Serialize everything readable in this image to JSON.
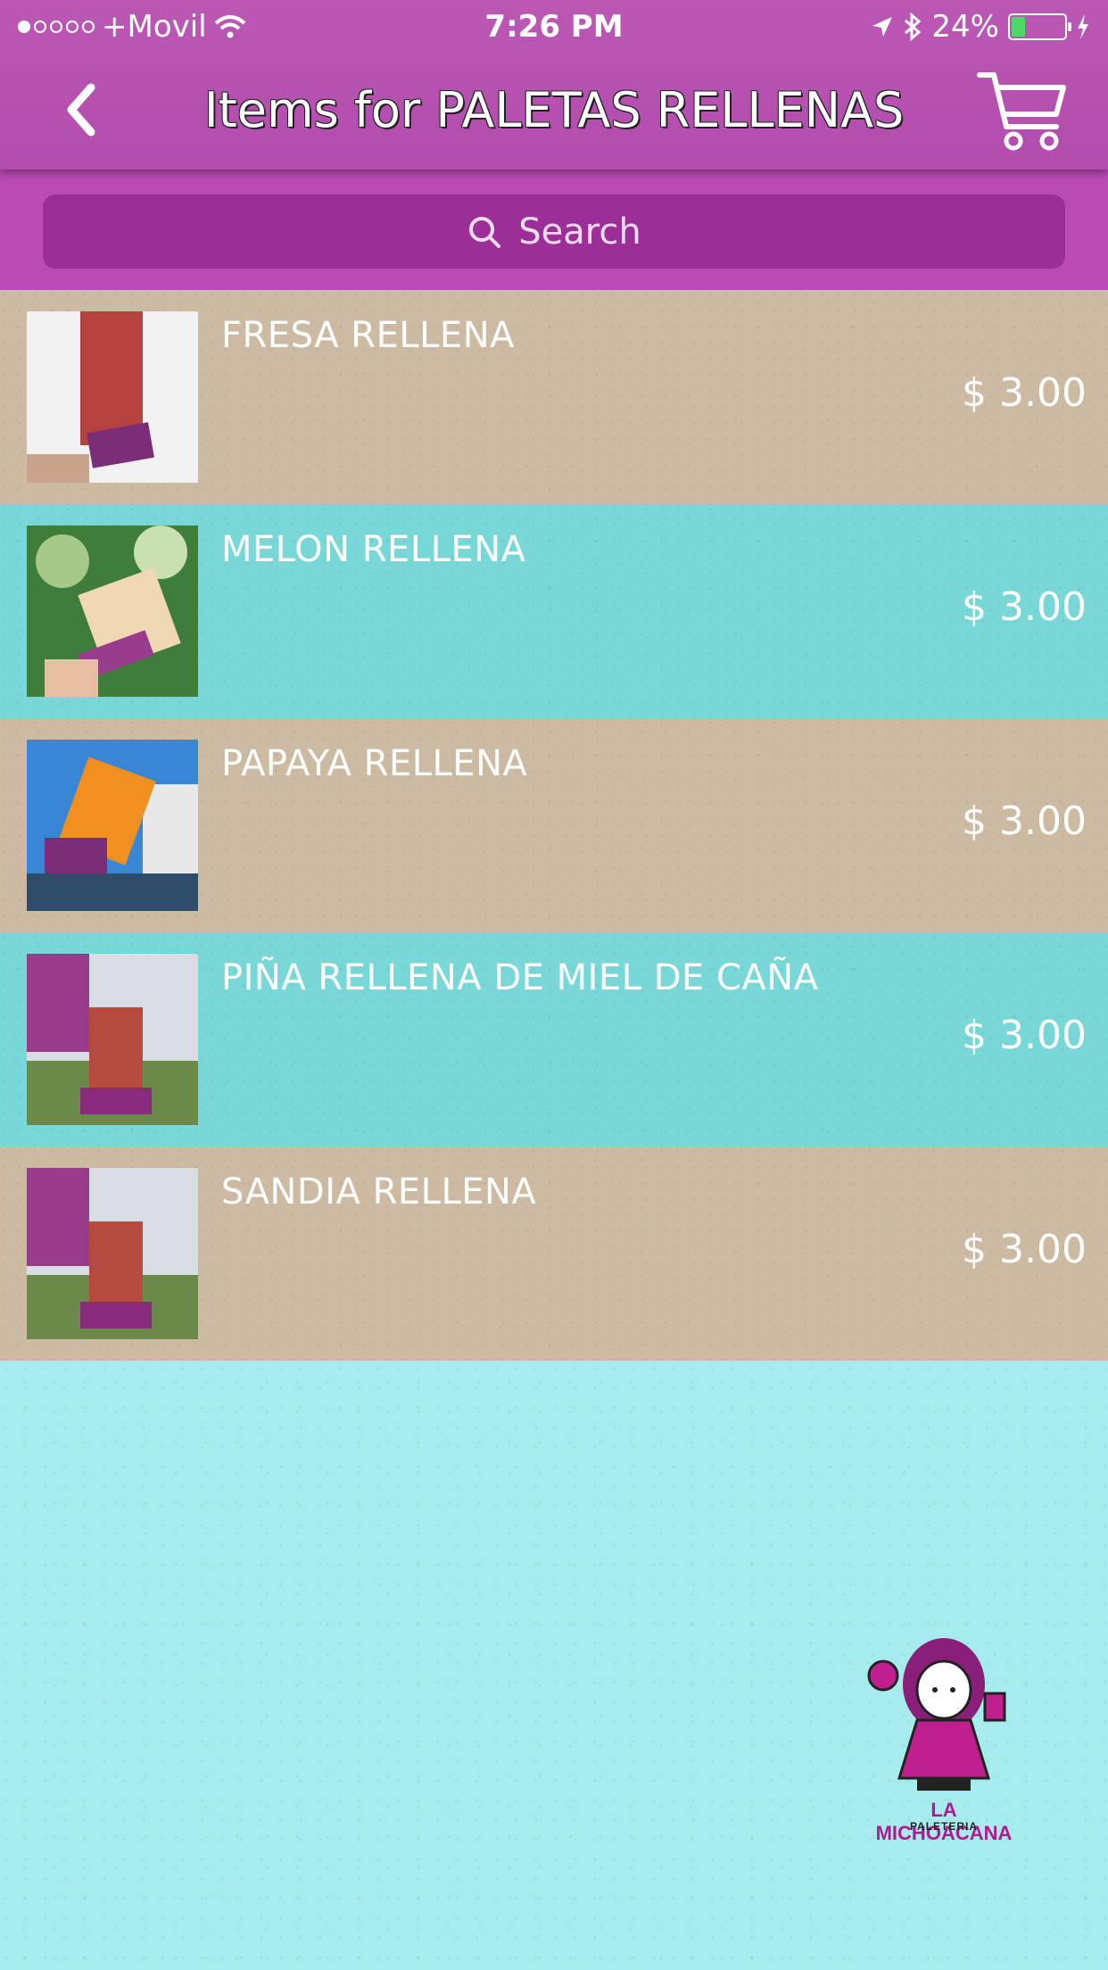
{
  "status_bar": {
    "carrier": "+Movil",
    "time": "7:26 PM",
    "battery": "24%",
    "battery_fill": 0.24
  },
  "nav": {
    "title": "Items for PALETAS RELLENAS",
    "back_icon": "chevron-left-icon",
    "cart_icon": "cart-icon"
  },
  "search": {
    "placeholder": "Search"
  },
  "items": [
    {
      "name": "FRESA RELLENA",
      "price": "$ 3.00",
      "bg": "#cdbaa2"
    },
    {
      "name": "MELON RELLENA",
      "price": "$ 3.00",
      "bg": "#78d8d8"
    },
    {
      "name": "PAPAYA RELLENA",
      "price": "$ 3.00",
      "bg": "#cdbaa2"
    },
    {
      "name": "PIÑA RELLENA DE MIEL DE CAÑA",
      "price": "$ 3.00",
      "bg": "#78d8d8"
    },
    {
      "name": "SANDIA RELLENA",
      "price": "$ 3.00",
      "bg": "#cdbaa2"
    }
  ],
  "logo": {
    "title": "LA MICHOACANA",
    "subtitle": "PALETERIA"
  },
  "colors": {
    "header": "#b24cae",
    "search_box": "#9c2f97",
    "accent_teal": "#a6ecec"
  }
}
